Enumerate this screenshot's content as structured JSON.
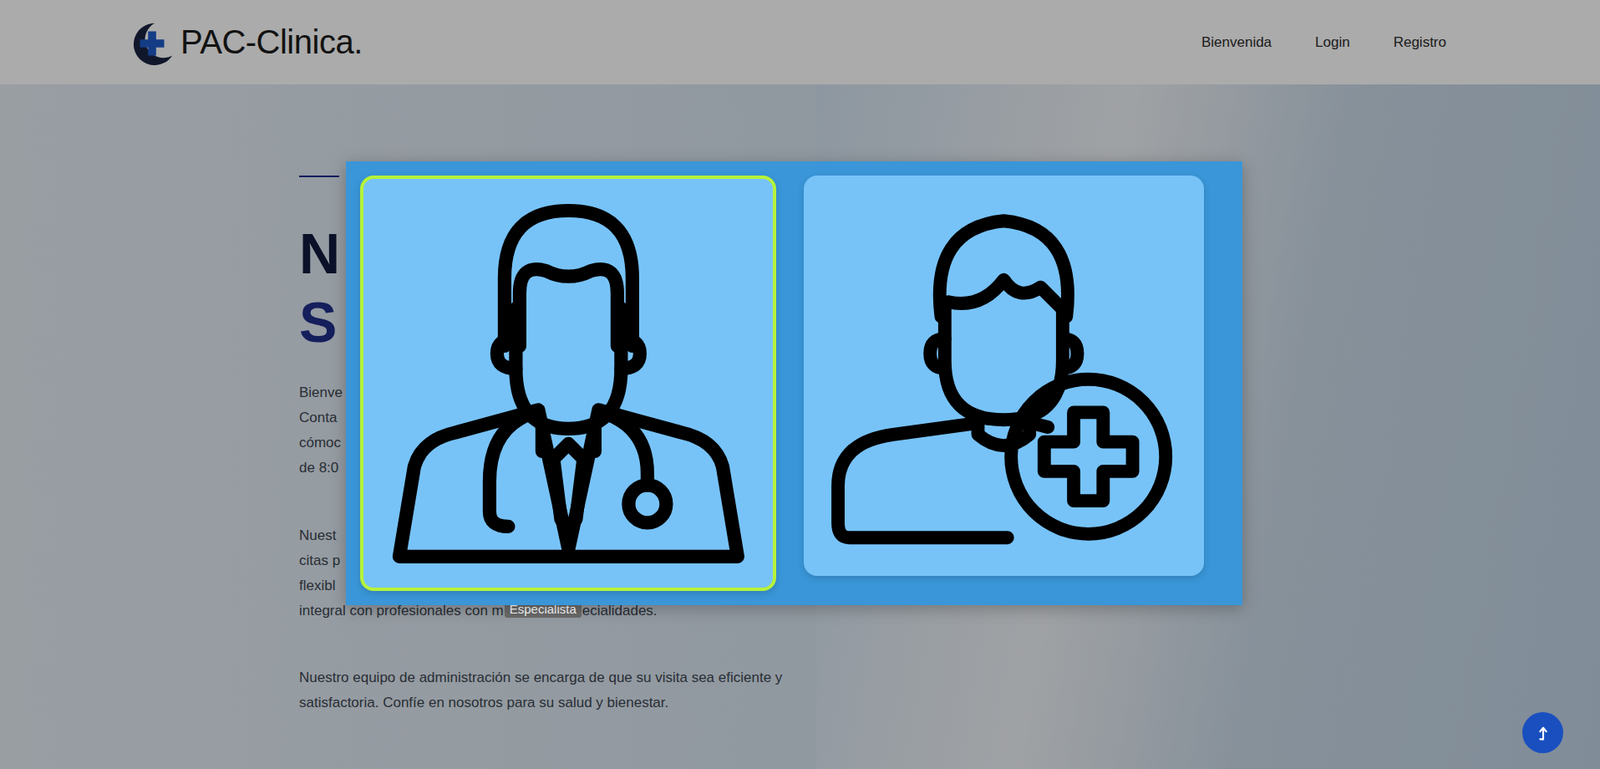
{
  "header": {
    "logo_text": "PAC-Clinica.",
    "nav": [
      {
        "label": "Bienvenida"
      },
      {
        "label": "Login"
      },
      {
        "label": "Registro"
      }
    ]
  },
  "hero": {
    "heading": [
      "N",
      "S"
    ],
    "paragraph1": [
      "Bienve",
      "Conta",
      "cómoc",
      "de 8:0"
    ],
    "paragraph2": [
      "Nuest",
      "citas p",
      "flexibl"
    ],
    "paragraph2_last": {
      "before": "integral con profesionales con m",
      "after": "ecialidades."
    },
    "paragraph3": [
      "Nuestro equipo de administración se encarga de que su visita sea eficiente y",
      "satisfactoria. Confíe en nosotros para su salud y bienestar."
    ]
  },
  "modal": {
    "options": [
      {
        "kind": "doctor",
        "selected": true
      },
      {
        "kind": "patient",
        "selected": false
      }
    ],
    "tooltip": "Especialista"
  }
}
